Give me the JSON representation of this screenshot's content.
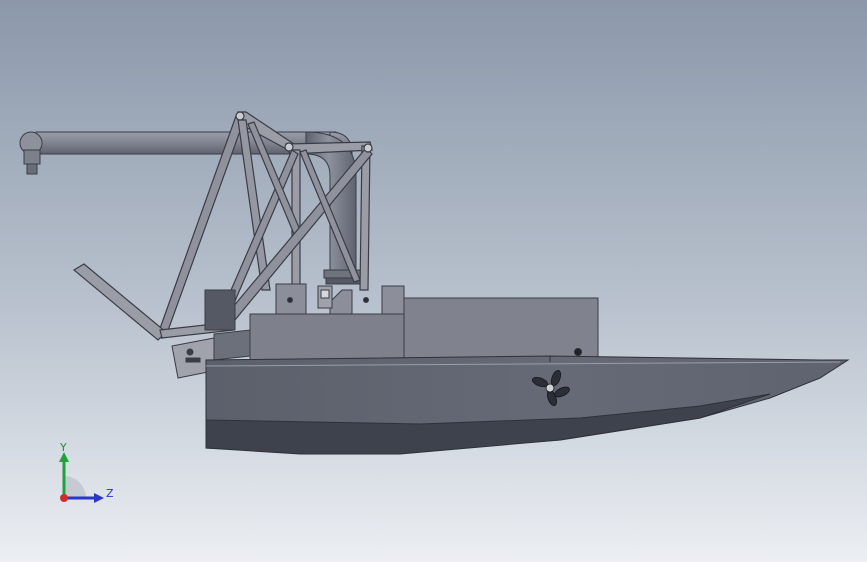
{
  "viewport": {
    "background_top": "#8c99aa",
    "background_bottom": "#e9ecf1"
  },
  "model": {
    "hull_color": "#61646f",
    "hull_dark": "#3f434c",
    "deck_color": "#7a7d88",
    "frame_color": "#8e919b",
    "pipe_color": "#7f838f",
    "propeller_color": "#2b2e36"
  },
  "triad": {
    "y_label": "Y",
    "z_label": "Z",
    "y_color": "#20a13b",
    "z_color": "#2a35c9",
    "origin_color": "#d12b2b"
  }
}
